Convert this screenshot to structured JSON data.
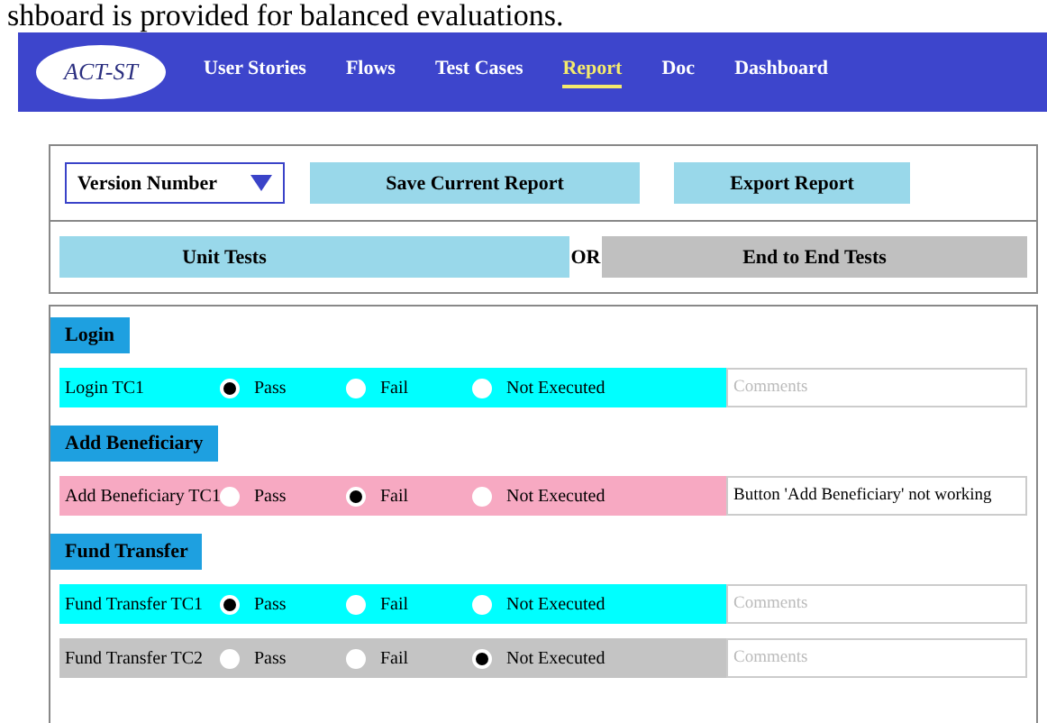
{
  "caption": "shboard is provided for balanced evaluations.",
  "nav": {
    "logo": "ACT-ST",
    "items": [
      {
        "label": "User Stories",
        "selected": false
      },
      {
        "label": "Flows",
        "selected": false
      },
      {
        "label": "Test Cases",
        "selected": false
      },
      {
        "label": "Report",
        "selected": true
      },
      {
        "label": "Doc",
        "selected": false
      },
      {
        "label": "Dashboard",
        "selected": false
      }
    ]
  },
  "toolbar": {
    "version_dropdown": "Version Number",
    "buttons": [
      "Save Current Report",
      "Export Report"
    ]
  },
  "test_type": {
    "options": [
      {
        "label": "Unit Tests",
        "selected": true
      },
      {
        "label": "End to End Tests",
        "selected": false
      }
    ],
    "separator": "OR"
  },
  "sections": [
    {
      "title": "Login",
      "rows": [
        {
          "name": "Login TC1",
          "options": [
            {
              "label": "Pass",
              "selected": true
            },
            {
              "label": "Fail",
              "selected": false
            },
            {
              "label": "Not Executed",
              "selected": false
            }
          ],
          "comment": {
            "placeholder": "Comments"
          }
        }
      ]
    },
    {
      "title": "Add Beneficiary",
      "rows": [
        {
          "name": "Add Beneficiary TC1",
          "options": [
            {
              "label": "Pass",
              "selected": false
            },
            {
              "label": "Fail",
              "selected": true
            },
            {
              "label": "Not Executed",
              "selected": false
            }
          ],
          "comment": {
            "value": "Button 'Add Beneficiary' not working"
          }
        }
      ]
    },
    {
      "title": "Fund Transfer",
      "rows": [
        {
          "name": "Fund Transfer TC1",
          "options": [
            {
              "label": "Pass",
              "selected": true
            },
            {
              "label": "Fail",
              "selected": false
            },
            {
              "label": "Not Executed",
              "selected": false
            }
          ],
          "comment": {
            "placeholder": "Comments"
          }
        },
        {
          "name": "Fund Transfer TC2",
          "options": [
            {
              "label": "Pass",
              "selected": false
            },
            {
              "label": "Fail",
              "selected": false
            },
            {
              "label": "Not Executed",
              "selected": true
            }
          ],
          "comment": {
            "placeholder": "Comments"
          }
        }
      ]
    }
  ]
}
